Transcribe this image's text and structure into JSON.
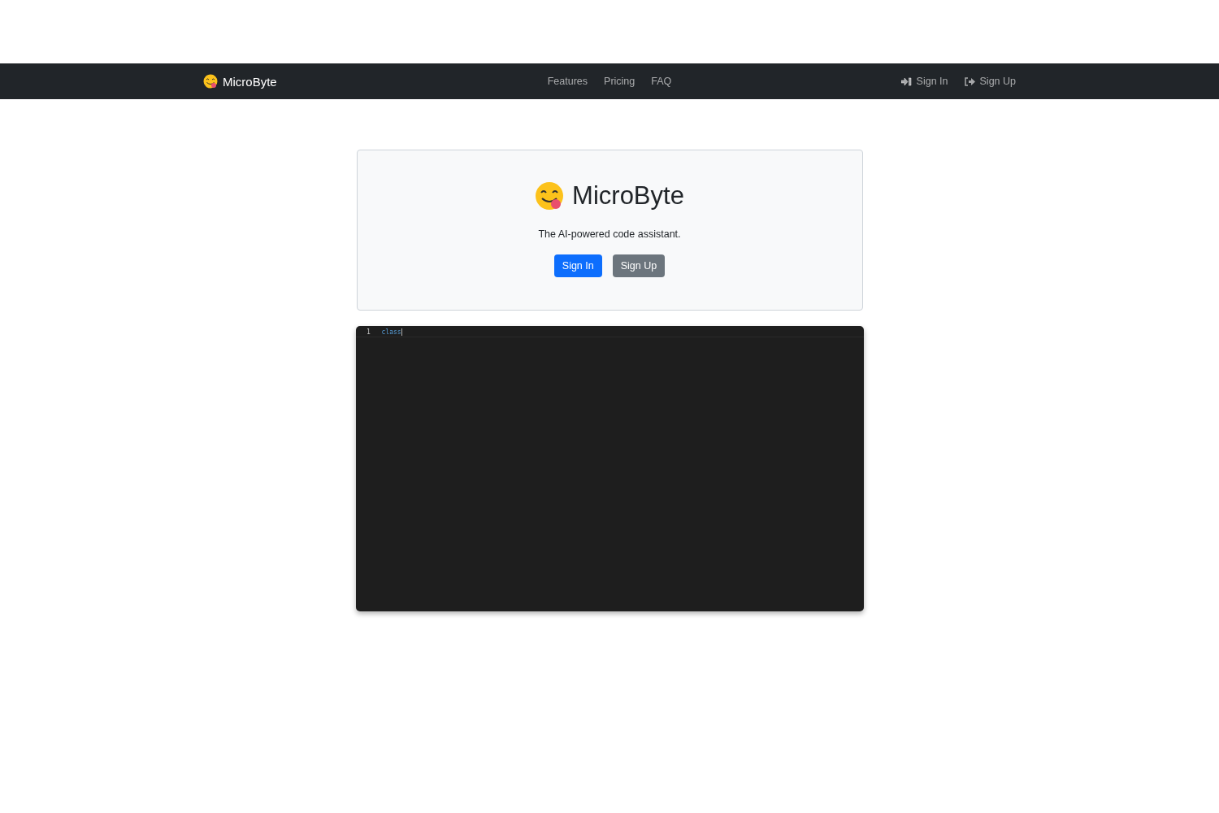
{
  "navbar": {
    "brand": "MicroByte",
    "links": [
      {
        "label": "Features"
      },
      {
        "label": "Pricing"
      },
      {
        "label": "FAQ"
      }
    ],
    "actions": [
      {
        "kind": "signin",
        "label": "Sign In"
      },
      {
        "kind": "signup",
        "label": "Sign Up"
      }
    ]
  },
  "hero": {
    "title": "MicroByte",
    "tagline": "The AI-powered code assistant.",
    "buttons": [
      {
        "kind": "primary",
        "label": "Sign In"
      },
      {
        "kind": "secondary",
        "label": "Sign Up"
      }
    ]
  },
  "editor": {
    "lines": [
      {
        "number": "1",
        "code": "class"
      }
    ]
  }
}
